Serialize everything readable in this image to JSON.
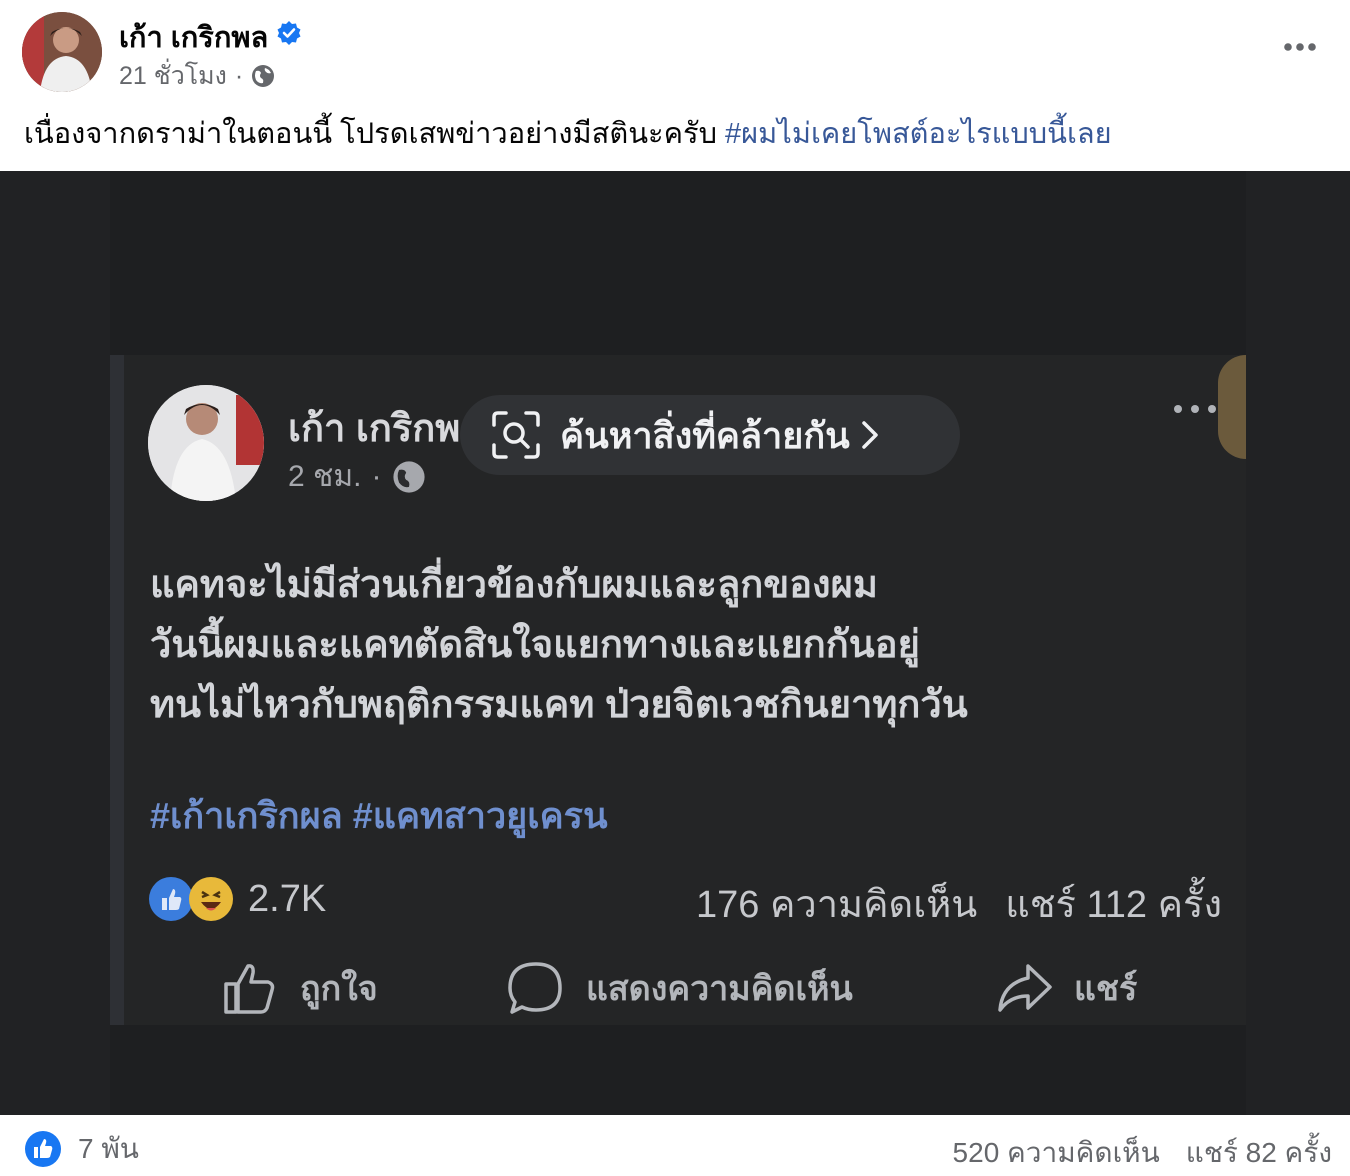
{
  "post": {
    "author": "เก้า เกริกพล",
    "time": "21 ชั่วโมง",
    "separator": "·",
    "caption_text": "เนื่องจากดราม่าในตอนนี้ โปรดเสพข่าวอย่างมีสตินะครับ ",
    "caption_hashtag": "#ผมไม่เคยโพสต์อะไรแบบนี้เลย",
    "icons": {
      "verified": "verified-badge-icon",
      "privacy": "globe-icon",
      "more": "more-options-icon"
    },
    "colors": {
      "link": "#385898",
      "verified": "#1877f2",
      "muted": "#65676b"
    }
  },
  "embedded_screenshot": {
    "author": "เก้า เกริกพ",
    "time": "2 ชม.",
    "separator": "·",
    "lens_label": "ค้นหาสิ่งที่คล้ายกัน",
    "lines": [
      "แคทจะไม่มีส่วนเกี่ยวข้องกับผมและลูกของผม",
      "วันนี้ผมและแคทตัดสินใจแยกทางและแยกกันอยู่",
      "ทนไม่ไหวกับพฤติกรรมแคท ป่วยจิตเวชกินยาทุกวัน"
    ],
    "hashtags": "#เก้าเกริกผล #แคทสาวยูเครน",
    "reaction_count": "2.7K",
    "comments": "176 ความคิดเห็น",
    "shares": "แชร์ 112 ครั้ง",
    "actions": {
      "like": "ถูกใจ",
      "comment": "แสดงความคิดเห็น",
      "share": "แชร์"
    }
  },
  "footer": {
    "likes": "7 พัน",
    "comments": "520 ความคิดเห็น",
    "shares": "แชร์ 82 ครั้ง"
  }
}
